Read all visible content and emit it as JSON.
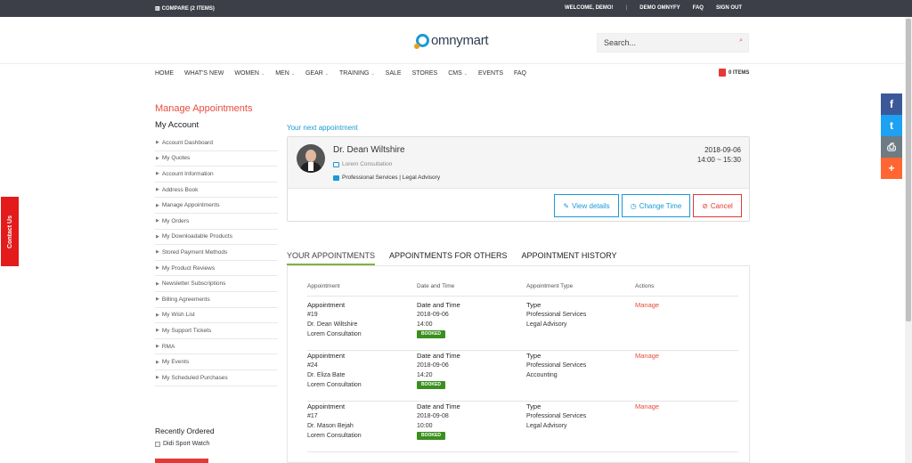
{
  "topbar": {
    "compare": "COMPARE (2 ITEMS)",
    "welcome": "WELCOME, DEMO!",
    "account": "DEMO OMNYFY",
    "faq": "FAQ",
    "signout": "SIGN OUT"
  },
  "header": {
    "logo": "omnymart",
    "search_placeholder": "Search..."
  },
  "nav": {
    "items": [
      "HOME",
      "WHAT'S NEW",
      "WOMEN",
      "MEN",
      "GEAR",
      "TRAINING",
      "SALE",
      "STORES",
      "CMS",
      "EVENTS",
      "FAQ"
    ],
    "cart": "0 ITEMS"
  },
  "sidebar": {
    "page_title": "Manage Appointments",
    "title": "My Account",
    "items": [
      "Account Dashboard",
      "My Quotes",
      "Account Information",
      "Address Book",
      "Manage Appointments",
      "My Orders",
      "My Downloadable Products",
      "Stored Payment Methods",
      "My Product Reviews",
      "Newsletter Subscriptions",
      "Billing Agreements",
      "My Wish List",
      "My Support Tickets",
      "RMA",
      "My Events",
      "My Scheduled Purchases"
    ],
    "recent_title": "Recently Ordered",
    "recent_item": "Didi Sport Watch"
  },
  "contact": "Contact Us",
  "next": {
    "label": "Your next appointment",
    "name": "Dr. Dean Wiltshire",
    "consultation": "Lorem Consultation",
    "services": "Professional Services | Legal Advisory",
    "date": "2018-09-06",
    "time": "14:00 ~ 15:30",
    "view_details": "View details",
    "change_time": "Change Time",
    "cancel": "Cancel"
  },
  "tabs": [
    "YOUR APPOINTMENTS",
    "APPOINTMENTS FOR OTHERS",
    "APPOINTMENT HISTORY"
  ],
  "table": {
    "headers": [
      "Appointment",
      "Date and Time",
      "Appointment Type",
      "Actions"
    ],
    "rows": [
      {
        "label": "Appointment",
        "id": "#19",
        "doctor": "Dr. Dean Wiltshire",
        "consult": "Lorem Consultation",
        "dt_label": "Date and Time",
        "date": "2018-09-06",
        "time": "14:00",
        "status": "BOOKED",
        "type_label": "Type",
        "type1": "Professional Services",
        "type2": "Legal Advisory",
        "action": "Manage"
      },
      {
        "label": "Appointment",
        "id": "#24",
        "doctor": "Dr. Eliza Bate",
        "consult": "Lorem Consultation",
        "dt_label": "Date and Time",
        "date": "2018-09-06",
        "time": "14:20",
        "status": "BOOKED",
        "type_label": "Type",
        "type1": "Professional Services",
        "type2": "Accounting",
        "action": "Manage"
      },
      {
        "label": "Appointment",
        "id": "#17",
        "doctor": "Dr. Mason Bejah",
        "consult": "Lorem Consultation",
        "dt_label": "Date and Time",
        "date": "2018-09-08",
        "time": "10:00",
        "status": "BOOKED",
        "type_label": "Type",
        "type1": "Professional Services",
        "type2": "Legal Advisory",
        "action": "Manage"
      }
    ]
  },
  "social": [
    {
      "icon": "facebook-icon",
      "glyph": "f",
      "color": "#3b5998"
    },
    {
      "icon": "twitter-icon",
      "glyph": "t",
      "color": "#1da1f2"
    },
    {
      "icon": "print-icon",
      "glyph": "⎙",
      "color": "#6d7b84"
    },
    {
      "icon": "plus-icon",
      "glyph": "+",
      "color": "#ff6634"
    }
  ]
}
